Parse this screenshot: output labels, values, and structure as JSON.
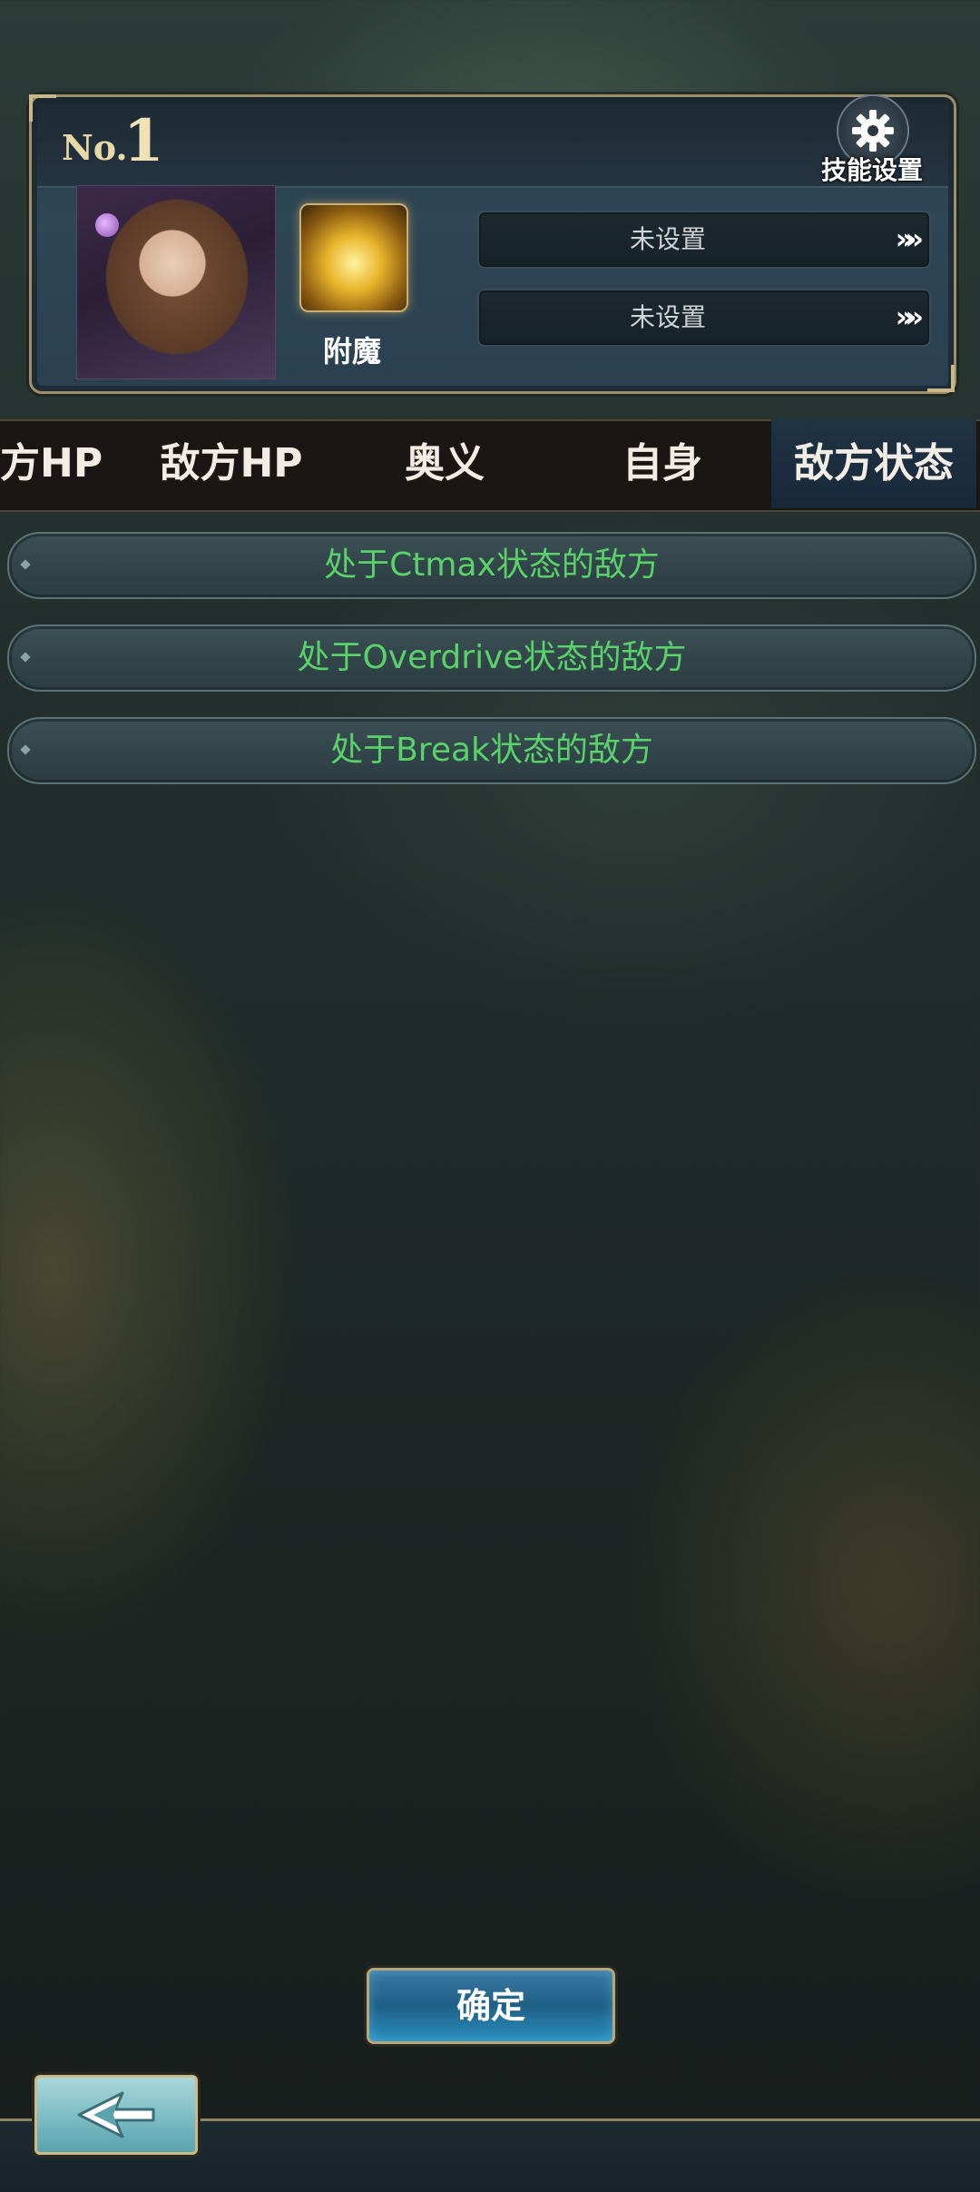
{
  "card": {
    "no_prefix": "No.",
    "no_value": "1",
    "skill_label": "附魔",
    "slots": [
      "未设置",
      "未设置"
    ],
    "slot_arrow": "»»",
    "settings_label": "技能设置"
  },
  "tabs": [
    {
      "label": "方HP",
      "active": false
    },
    {
      "label": "敌方HP",
      "active": false
    },
    {
      "label": "奥义",
      "active": false
    },
    {
      "label": "自身",
      "active": false
    },
    {
      "label": "敌方状态",
      "active": true
    }
  ],
  "conditions": [
    "处于Ctmax状态的敌方",
    "处于Overdrive状态的敌方",
    "处于Break状态的敌方"
  ],
  "confirm_label": "确定",
  "colors": {
    "condition_text": "#59d26a",
    "active_tab_bg": "#1f3343",
    "gold_border": "#b8a77a"
  }
}
